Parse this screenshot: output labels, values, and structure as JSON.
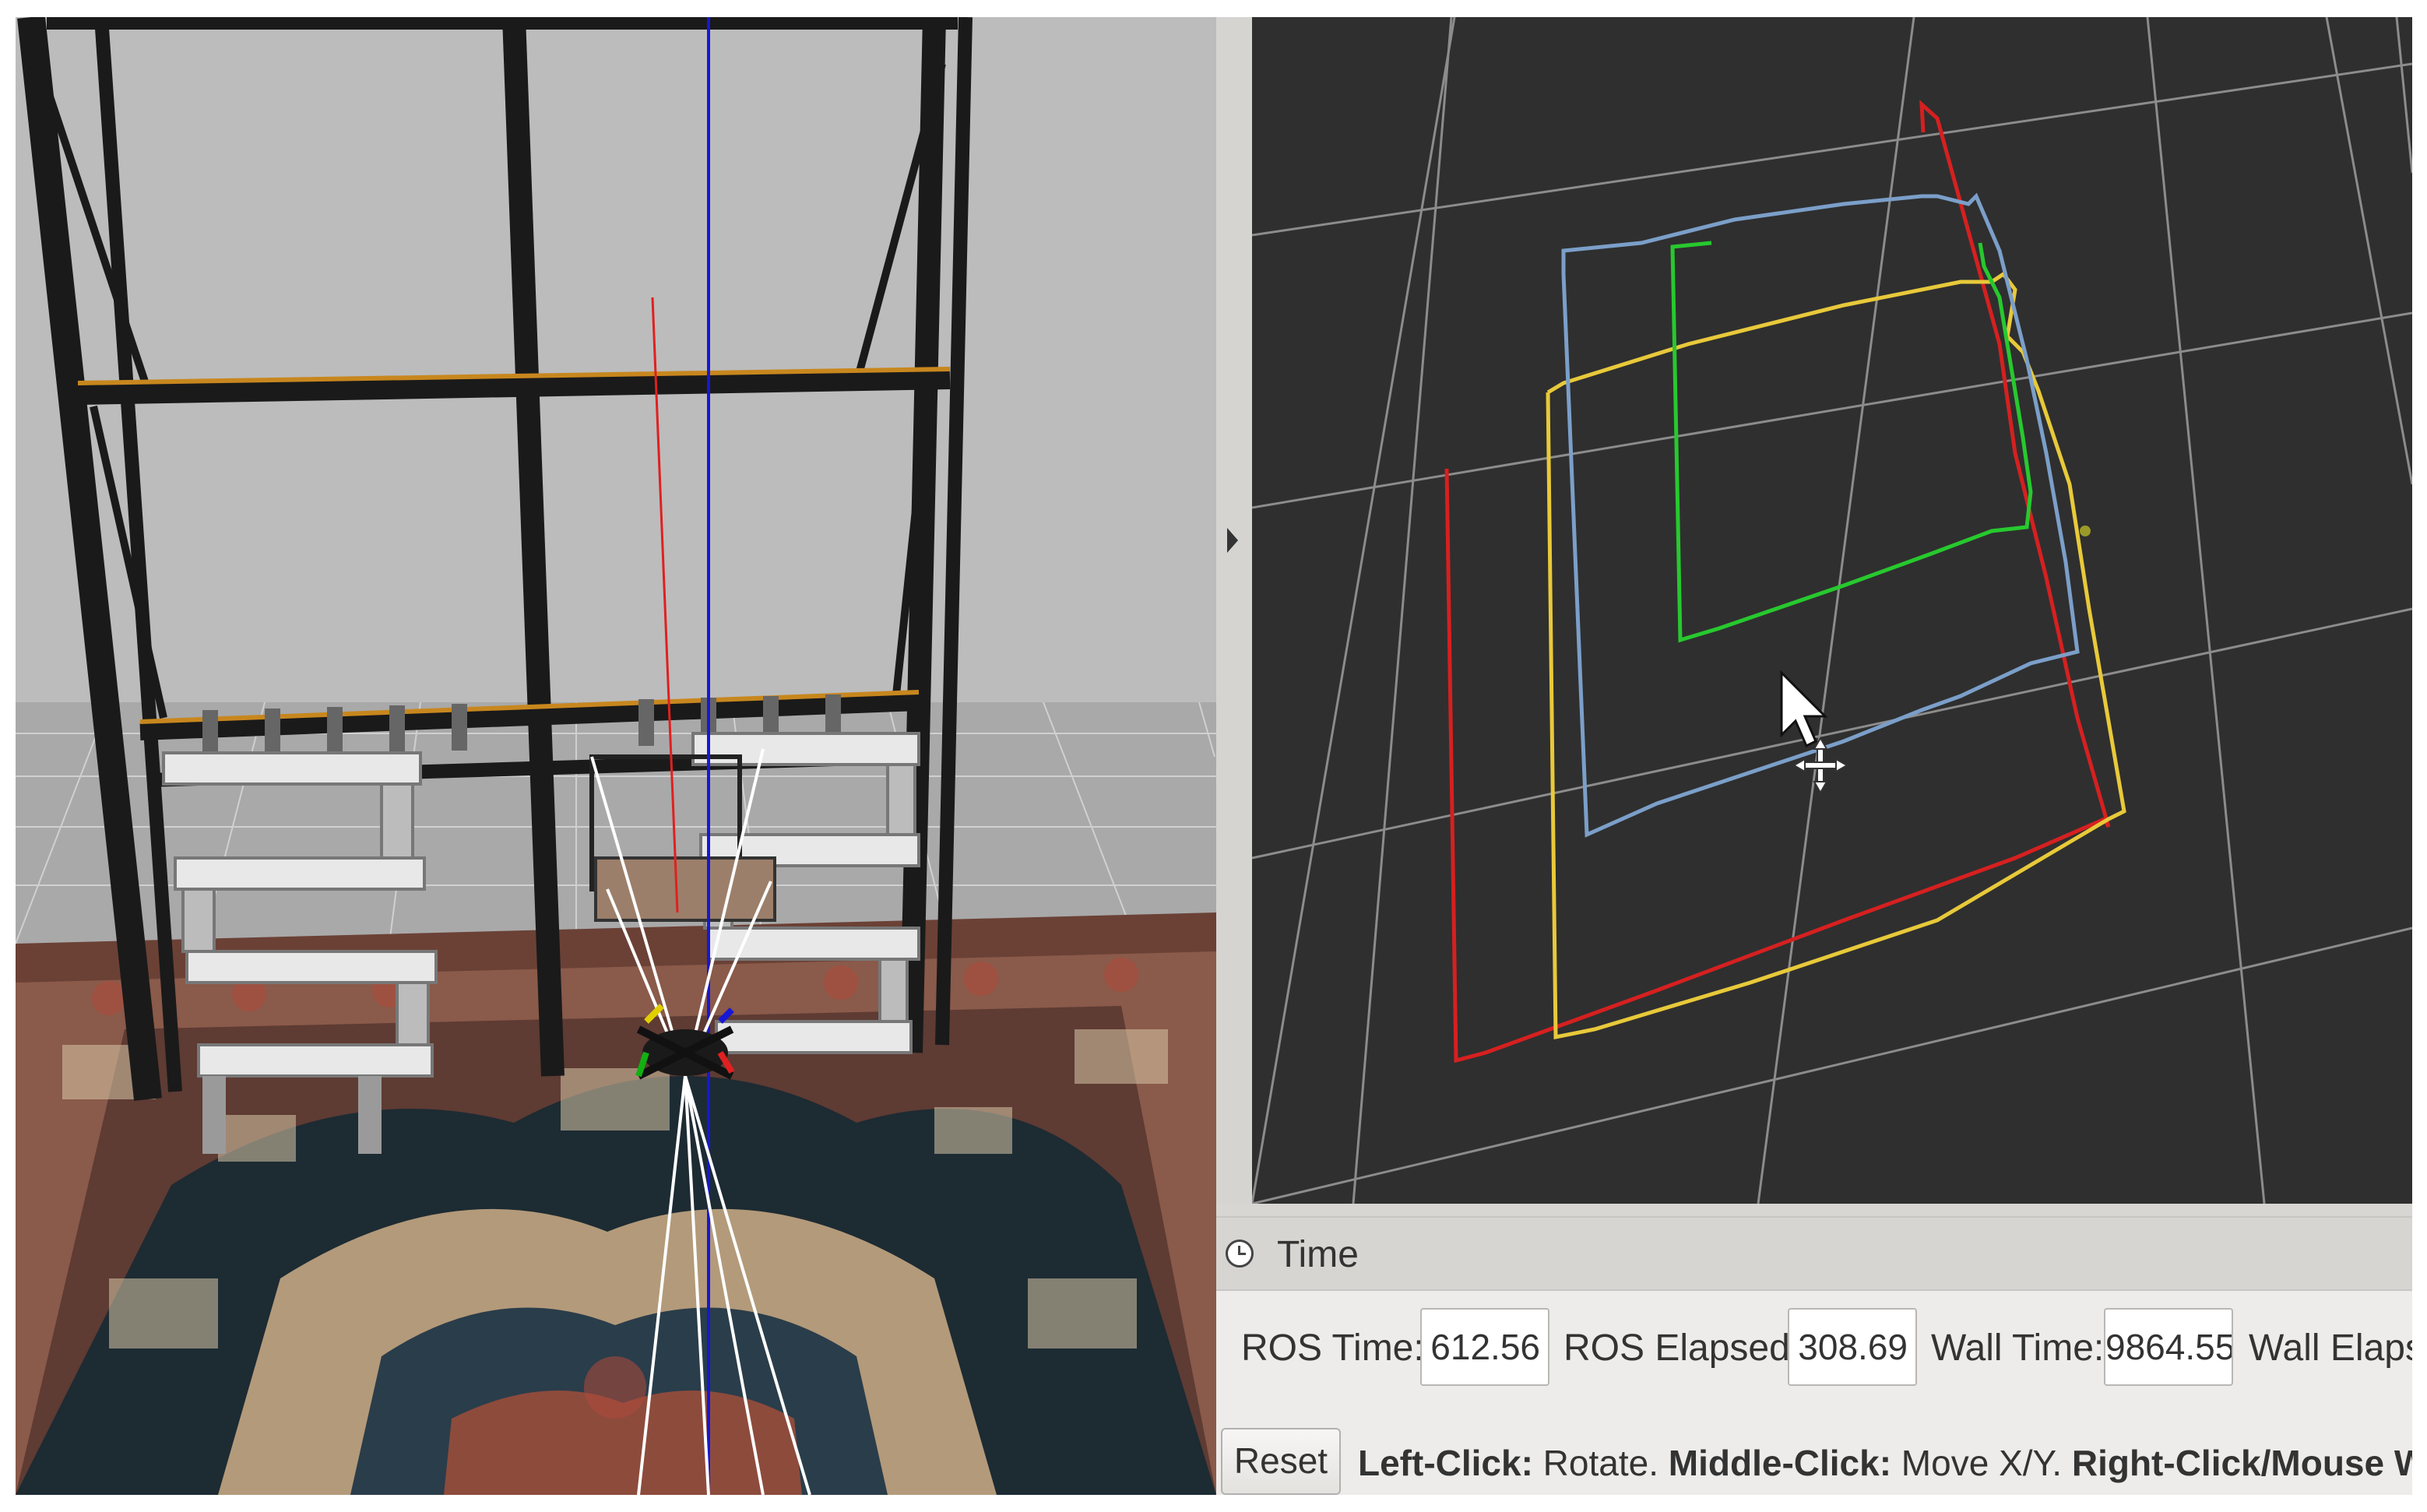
{
  "time_panel": {
    "title": "Time",
    "ros_time_label": "ROS Time:",
    "ros_time_value": "612.56",
    "ros_elapsed_label": "ROS Elapsed:",
    "ros_elapsed_value": "308.69",
    "wall_time_label": "Wall Time:",
    "wall_time_value": "9864.55",
    "wall_elapsed_label": "Wall Elapse",
    "reset_label": "Reset"
  },
  "hint": {
    "left_click": "Left-Click:",
    "left_action": " Rotate. ",
    "middle_click": "Middle-Click:",
    "middle_action": " Move X/Y. ",
    "right_click": "Right-Click/Mouse Wh"
  },
  "colors": {
    "viewport_bg": "#2f2f2f",
    "grid": "#8a8a8a",
    "path_red": "#d62020",
    "path_yellow": "#e8c93a",
    "path_blue": "#7b9fc9",
    "path_green": "#27c92e"
  },
  "icons": {
    "clock": "clock-icon",
    "mouse_pointer": "mouse-pointer-icon",
    "move_cursor": "move-cursor-icon",
    "splitter_arrow": "triangle-right-icon"
  }
}
